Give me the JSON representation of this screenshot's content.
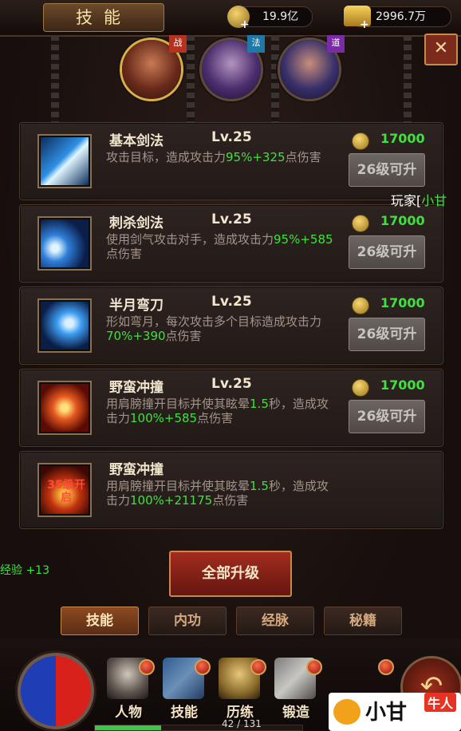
{
  "header": {
    "title": "技能",
    "silver": "19.9亿",
    "gold": "2996.7万"
  },
  "classes": [
    {
      "badge": "战",
      "color": "#b5321f"
    },
    {
      "badge": "法",
      "color": "#1e78a8"
    },
    {
      "badge": "道",
      "color": "#7a2ca6"
    }
  ],
  "skills": [
    {
      "name": "基本剑法",
      "level": "Lv.25",
      "desc": [
        "攻击目标，造成攻击力",
        "95%+325",
        "点伤害"
      ],
      "cost": "17000",
      "req": "26级可升",
      "icon": "sword-slash-icon"
    },
    {
      "name": "刺杀剑法",
      "level": "Lv.25",
      "desc": [
        "使用剑气攻击对手，造成攻击力",
        "95%+585",
        "点伤害"
      ],
      "cost": "17000",
      "req": "26级可升",
      "icon": "thrust-icon"
    },
    {
      "name": "半月弯刀",
      "level": "Lv.25",
      "desc": [
        "形如弯月，每次攻击多个目标造成攻击力",
        "70%+390",
        "点伤害"
      ],
      "cost": "17000",
      "req": "26级可升",
      "icon": "crescent-blade-icon"
    },
    {
      "name": "野蛮冲撞",
      "level": "Lv.25",
      "desc": [
        "用肩膀撞开目标并使其眩晕",
        "1.5",
        "秒，造成攻击力",
        "100%+585",
        "点伤害"
      ],
      "cost": "17000",
      "req": "26级可升",
      "icon": "charge-icon"
    },
    {
      "name": "野蛮冲撞",
      "level": "",
      "desc": [
        "用肩膀撞开目标并使其眩晕",
        "1.5",
        "秒，造成攻击力",
        "100%+21175",
        "点伤害"
      ],
      "locked_label": "35级开启",
      "icon": "locked-skill-icon"
    }
  ],
  "floating": {
    "player_prefix": "玩家[",
    "player_name": "小甘",
    "exp": "经验 +13"
  },
  "upgrade_all": "全部升级",
  "tabs": [
    "技能",
    "内功",
    "经脉",
    "秘籍"
  ],
  "nav": [
    "人物",
    "技能",
    "历练",
    "锻造"
  ],
  "page_counter": "42 / 131",
  "exp_progress": 0.32,
  "watermark": {
    "text": "小甘",
    "sub": "牛人"
  }
}
